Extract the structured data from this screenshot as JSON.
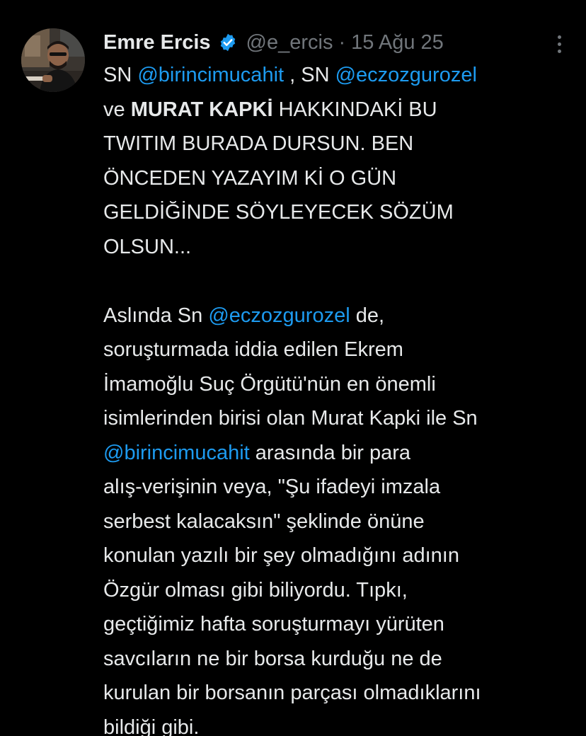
{
  "tweet": {
    "author": {
      "name": "Emre Ercis",
      "handle": "@e_ercis",
      "separator": "·",
      "date": "15 Ağu 25"
    },
    "colors": {
      "background": "#000000",
      "text": "#e7e9ea",
      "muted": "#71767b",
      "mention": "#1d9bf0",
      "verified_badge": "#1d9bf0"
    },
    "icons": {
      "verified": "verified-badge-icon",
      "more": "more-options-icon"
    },
    "body": {
      "p1": {
        "l1": {
          "a": "SN ",
          "b": "@birincimucahit",
          "c": " , SN ",
          "d": "@eczozgurozel"
        },
        "l2": {
          "a": "ve ",
          "b": "MURAT KAPKİ",
          "c": " HAKKINDAKİ BU"
        },
        "l3": "TWITIM BURADA DURSUN. BEN",
        "l4": "ÖNCEDEN YAZAYIM Kİ O GÜN",
        "l5": "GELDİĞİNDE SÖYLEYECEK SÖZÜM",
        "l6": "OLSUN..."
      },
      "p2": {
        "l1": {
          "a": "Aslında Sn ",
          "b": "@eczozgurozel",
          "c": " de,"
        },
        "l2": "soruşturmada iddia edilen Ekrem",
        "l3": "İmamoğlu Suç Örgütü'nün en önemli",
        "l4": "isimlerinden birisi olan Murat Kapki ile Sn",
        "l5": {
          "a": "@birincimucahit",
          "b": " arasında bir para"
        },
        "l6": "alış-verişinin veya, \"Şu ifadeyi imzala",
        "l7": "serbest kalacaksın\" şeklinde önüne",
        "l8": "konulan yazılı bir şey olmadığını adının",
        "l9": "Özgür olması gibi biliyordu. Tıpkı,",
        "l10": "geçtiğimiz hafta soruşturmayı yürüten",
        "l11": "savcıların ne bir borsa kurduğu ne de",
        "l12": "kurulan bir borsanın parçası olmadıklarını",
        "l13": "bildiği gibi."
      }
    }
  }
}
